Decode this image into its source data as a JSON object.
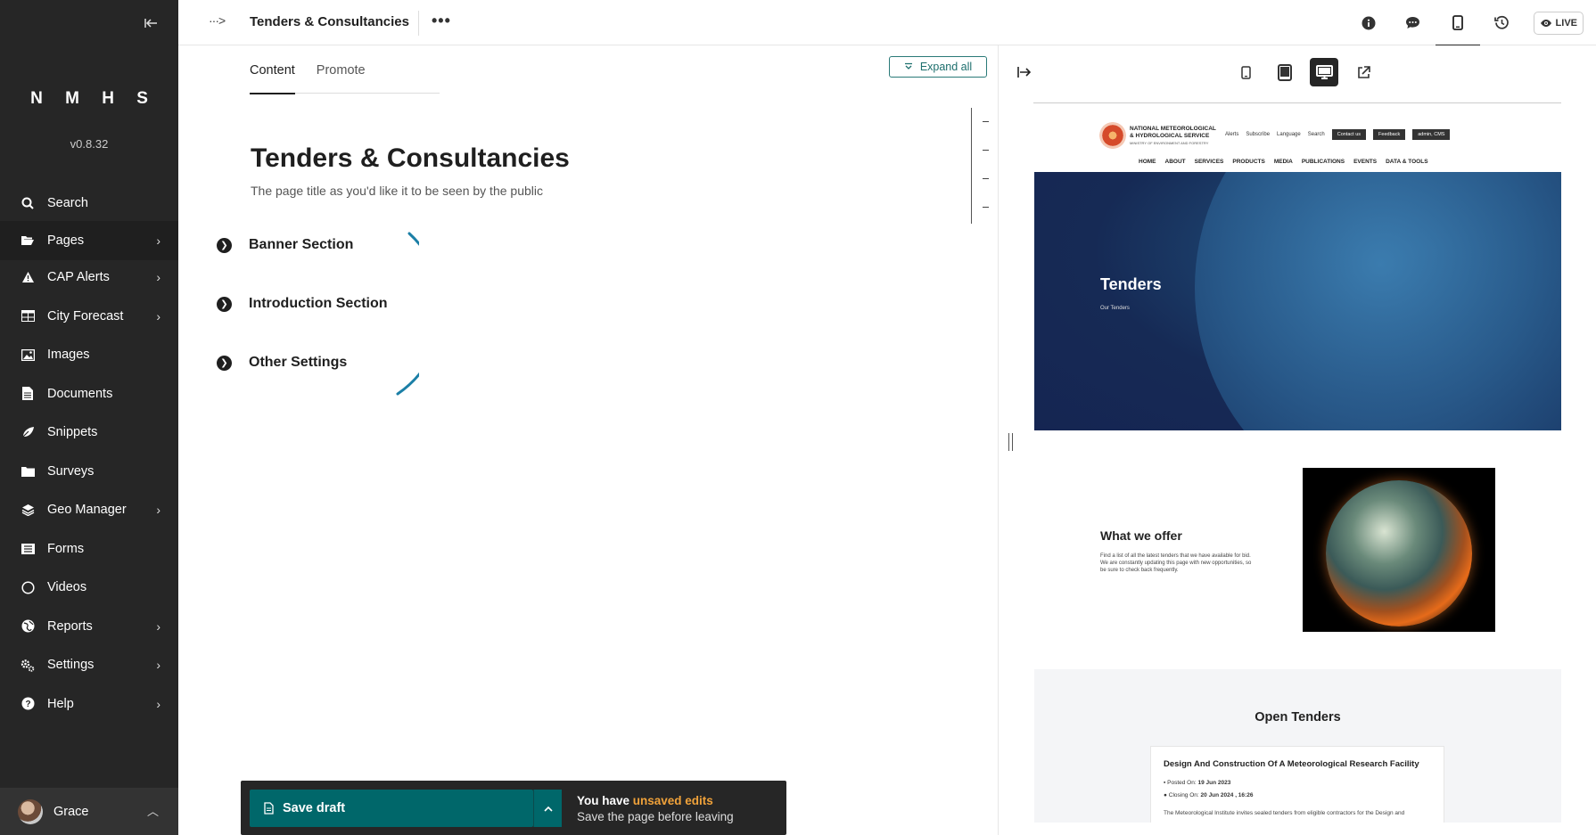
{
  "sidebar": {
    "logo": "N M H S",
    "version": "v0.8.32",
    "items": [
      {
        "label": "Search",
        "icon": "search-icon",
        "has_children": false
      },
      {
        "label": "Pages",
        "icon": "folder-open-icon",
        "has_children": true
      },
      {
        "label": "CAP Alerts",
        "icon": "warning-icon",
        "has_children": true
      },
      {
        "label": "City Forecast",
        "icon": "table-icon",
        "has_children": true
      },
      {
        "label": "Images",
        "icon": "image-icon",
        "has_children": false
      },
      {
        "label": "Documents",
        "icon": "document-icon",
        "has_children": false
      },
      {
        "label": "Snippets",
        "icon": "snippet-icon",
        "has_children": false
      },
      {
        "label": "Surveys",
        "icon": "folder-icon",
        "has_children": false
      },
      {
        "label": "Geo Manager",
        "icon": "layers-icon",
        "has_children": true
      },
      {
        "label": "Forms",
        "icon": "list-icon",
        "has_children": false
      },
      {
        "label": "Videos",
        "icon": "circle-icon",
        "has_children": false
      },
      {
        "label": "Reports",
        "icon": "globe-icon",
        "has_children": true
      },
      {
        "label": "Settings",
        "icon": "cogs-icon",
        "has_children": true
      },
      {
        "label": "Help",
        "icon": "help-icon",
        "has_children": true
      }
    ],
    "user": "Grace"
  },
  "header": {
    "breadcrumb_icon": "···>",
    "title": "Tenders & Consultancies",
    "more": "•••",
    "live_label": "LIVE"
  },
  "editor": {
    "tabs": [
      {
        "label": "Content",
        "active": true
      },
      {
        "label": "Promote",
        "active": false
      }
    ],
    "expand_all": "Expand all",
    "page_title": "Tenders & Consultancies",
    "page_title_help": "The page title as you'd like it to be seen by the public",
    "sections": [
      {
        "label": "Banner Section"
      },
      {
        "label": "Introduction Section"
      },
      {
        "label": "Other Settings"
      }
    ]
  },
  "savebar": {
    "save_label": "Save draft",
    "msg_prefix": "You have ",
    "msg_highlight": "unsaved edits",
    "msg_sub": "Save the page before leaving"
  },
  "preview": {
    "site": {
      "org_name": "NATIONAL METEOROLOGICAL & HYDROLOGICAL SERVICE",
      "org_tagline": "MINISTRY OF ENVIRONMENT AND FORESTRY",
      "util_links": [
        "Alerts",
        "Subscribe",
        "Language",
        "Search"
      ],
      "util_buttons": [
        "Contact us",
        "Feedback",
        "admin, CMS"
      ],
      "nav": [
        "HOME",
        "ABOUT",
        "SERVICES",
        "PRODUCTS",
        "MEDIA",
        "PUBLICATIONS",
        "EVENTS",
        "DATA & TOOLS"
      ],
      "hero_title": "Tenders",
      "hero_sub": "Our Tenders",
      "offer_title": "What we offer",
      "offer_text": "Find a list of all the latest tenders that we have available for bid. We are constantly updating this page with new opportunities, so be sure to check back frequently.",
      "tenders_title": "Open Tenders",
      "tender": {
        "title": "Design And Construction Of A Meteorological Research Facility",
        "posted_label": "Posted On:",
        "posted": "19 Jun 2023",
        "closing_label": "Closing On:",
        "closing": "20 Jun 2024 , 16:26",
        "desc": "The Meteorological Institute invites sealed tenders from eligible contractors for the Design and"
      }
    }
  },
  "colors": {
    "sidebar_bg": "#262626",
    "accent_teal": "#00676a",
    "unsaved_orange": "#f0a23a",
    "arc_blue": "#1b7fa6"
  }
}
